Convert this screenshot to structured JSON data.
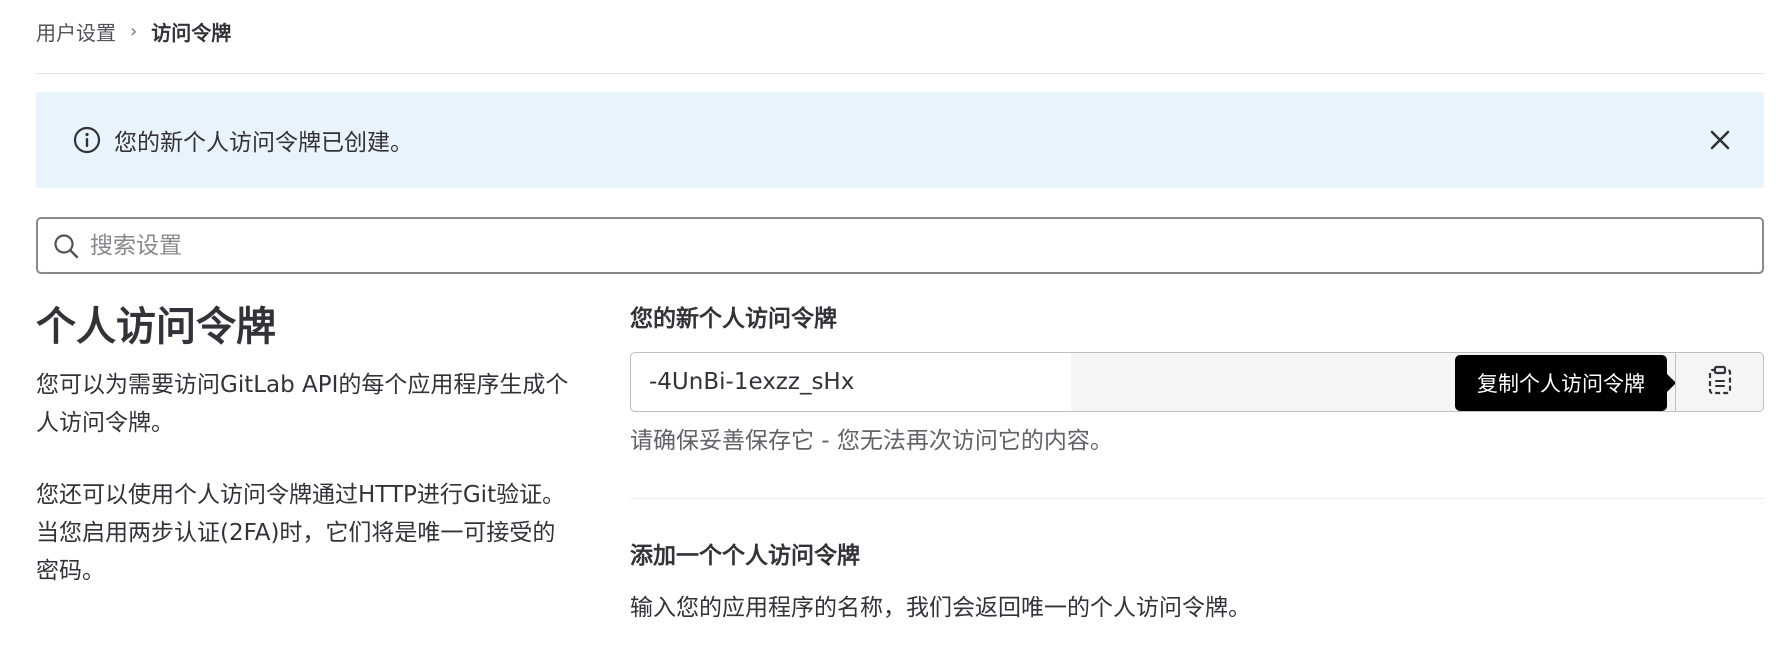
{
  "breadcrumb": {
    "parent": "用户设置",
    "separator": "›",
    "current": "访问令牌"
  },
  "alert": {
    "message": "您的新个人访问令牌已创建。",
    "icon": "info-icon",
    "close_icon": "close-icon",
    "background": "#e9f3fc"
  },
  "search": {
    "placeholder": "搜索设置",
    "value": "",
    "icon": "search-icon"
  },
  "section": {
    "title": "个人访问令牌",
    "description_1": "您可以为需要访问GitLab API的每个应用程序生成个人访问令牌。",
    "description_2": "您还可以使用个人访问令牌通过HTTP进行Git验证。 当您启用两步认证(2FA)时，它们将是唯一可接受的密码。"
  },
  "new_token": {
    "label": "您的新个人访问令牌",
    "value": "-4UnBi-1exzz_sHx",
    "copy_tooltip": "复制个人访问令牌",
    "copy_icon": "clipboard-icon",
    "hint": "请确保妥善保存它 - 您无法再次访问它的内容。"
  },
  "add_token": {
    "label": "添加一个个人访问令牌",
    "description": "输入您的应用程序的名称，我们会返回唯一的个人访问令牌。"
  }
}
